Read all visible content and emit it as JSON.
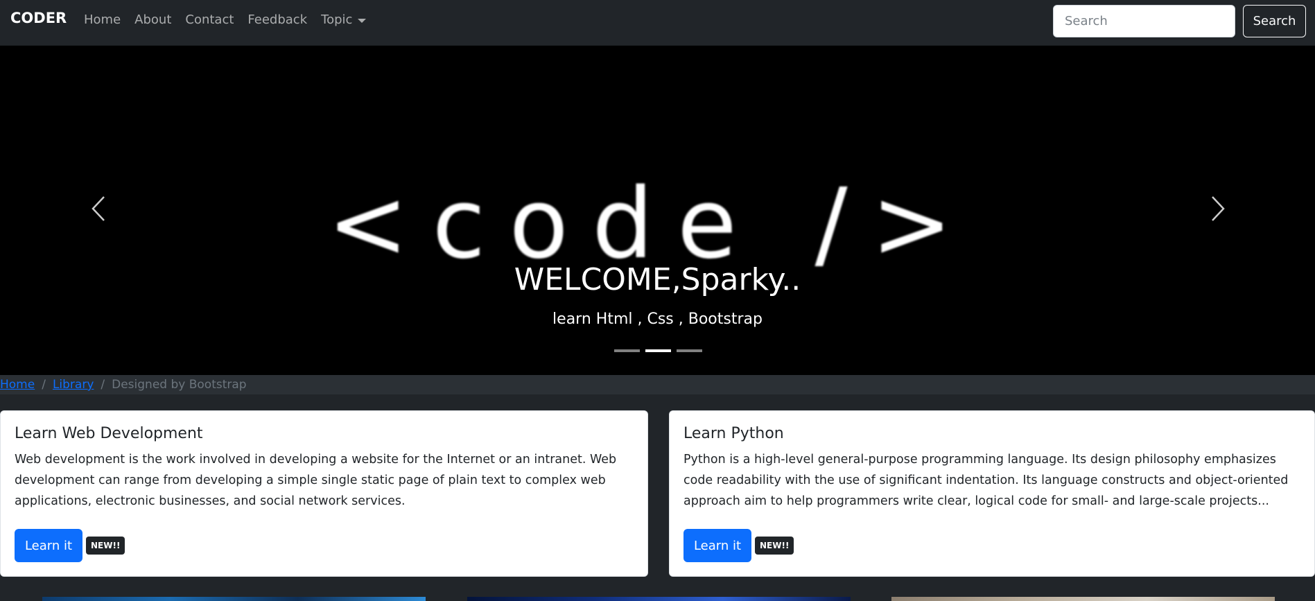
{
  "navbar": {
    "brand": "CODER",
    "links": [
      "Home",
      "About",
      "Contact",
      "Feedback"
    ],
    "dropdown_label": "Topic",
    "search_placeholder": "Search",
    "search_button": "Search"
  },
  "carousel": {
    "art_text": "<code />",
    "caption_title": "WELCOME,Sparky..",
    "caption_subtitle": "learn Html , Css , Bootstrap",
    "slide_count": 3,
    "active_slide": 2
  },
  "breadcrumb": {
    "items": [
      "Home",
      "Library"
    ],
    "current": "Designed by Bootstrap"
  },
  "cards": [
    {
      "title": "Learn Web Development",
      "text": "Web development is the work involved in developing a website for the Internet or an intranet. Web development can range from developing a simple single static page of plain text to complex web applications, electronic businesses, and social network services.",
      "button": "Learn it",
      "badge": "NEW!!"
    },
    {
      "title": "Learn Python",
      "text": "Python is a high-level general-purpose programming language. Its design philosophy emphasizes code readability with the use of significant indentation. Its language constructs and object-oriented approach aim to help programmers write clear, logical code for small- and large-scale projects...",
      "button": "Learn it",
      "badge": "NEW!!"
    }
  ],
  "colors": {
    "navbar_bg": "#212529",
    "primary": "#0d6efd",
    "carousel_bg": "#000000"
  }
}
